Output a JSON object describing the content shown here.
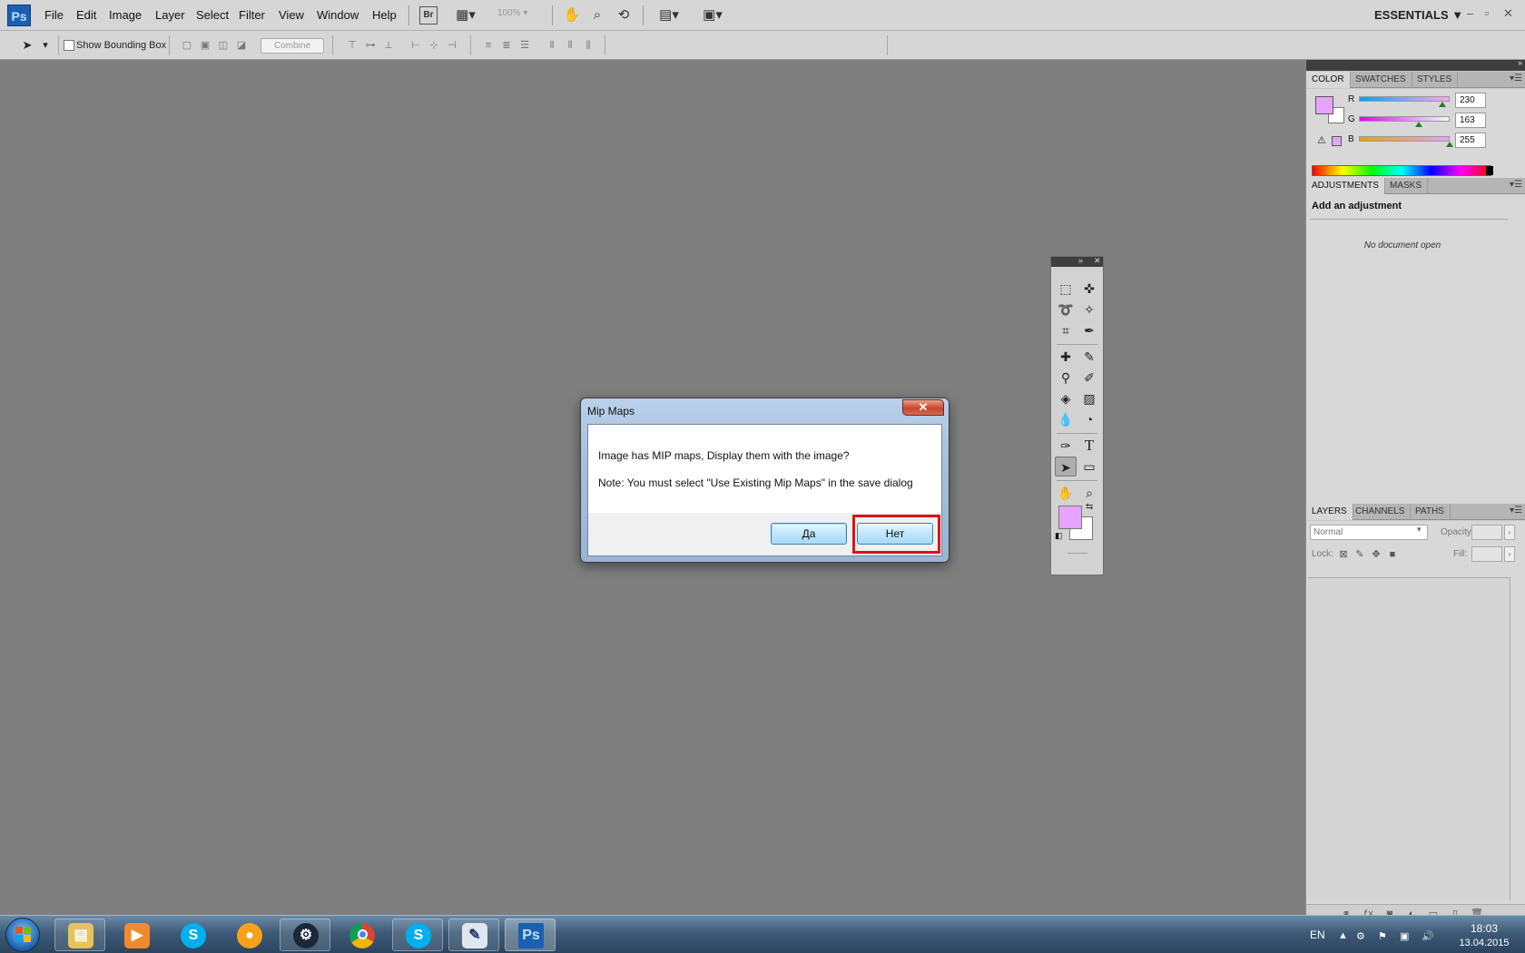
{
  "app": {
    "logo": "Ps",
    "menu": [
      "File",
      "Edit",
      "Image",
      "Layer",
      "Select",
      "Filter",
      "View",
      "Window",
      "Help"
    ],
    "bridge_icon": "Br",
    "zoom": "100%",
    "workspace": "ESSENTIALS",
    "workspace_arrow": "▼",
    "window_controls": [
      "–",
      "▫",
      "✕"
    ]
  },
  "options_bar": {
    "show_bounding_box_label": "Show Bounding Box",
    "show_bounding_box_checked": false,
    "combine_label": "Combine"
  },
  "color_panel": {
    "tabs": [
      "COLOR",
      "SWATCHES",
      "STYLES"
    ],
    "active_tab": "COLOR",
    "channels": [
      {
        "label": "R",
        "value": "230"
      },
      {
        "label": "G",
        "value": "163"
      },
      {
        "label": "B",
        "value": "255"
      }
    ],
    "foreground_color": "#e6a3ff",
    "background_color": "#ffffff"
  },
  "adjustments_panel": {
    "tabs": [
      "ADJUSTMENTS",
      "MASKS"
    ],
    "title": "Add an adjustment",
    "empty_message": "No document open"
  },
  "layers_panel": {
    "tabs": [
      "LAYERS",
      "CHANNELS",
      "PATHS"
    ],
    "blend_mode": "Normal",
    "opacity_label": "Opacity:",
    "lock_label": "Lock:",
    "fill_label": "Fill:"
  },
  "dialog": {
    "title": "Mip Maps",
    "close_glyph": "✕",
    "message_line1": "Image has MIP maps, Display them with the image?",
    "message_line2": "Note: You must select \"Use Existing Mip Maps\" in the save dialog",
    "yes_label": "Да",
    "no_label": "Нет"
  },
  "taskbar": {
    "language": "EN",
    "time": "18:03",
    "date": "13.04.2015",
    "apps": [
      "file-explorer",
      "media-player",
      "skype",
      "messenger",
      "steam",
      "chrome",
      "skype",
      "image-editor",
      "photoshop"
    ]
  },
  "colors": {
    "canvas_bg": "#7f7f7f",
    "highlight": "#d8141c",
    "accent": "#1b5fb3"
  }
}
